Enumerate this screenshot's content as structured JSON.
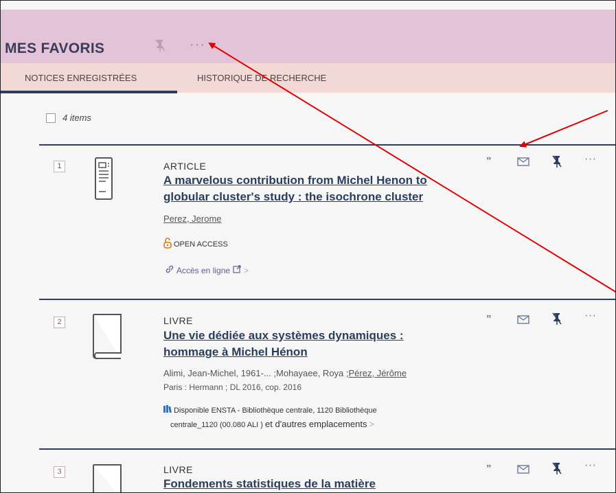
{
  "header": {
    "title": "MES FAVORIS",
    "more": "···"
  },
  "tabs": [
    {
      "label": "NOTICES ENREGISTRÉES"
    },
    {
      "label": "HISTORIQUE DE RECHERCHE"
    }
  ],
  "items_count": "4 items",
  "items": [
    {
      "index": "1",
      "type": "ARTICLE",
      "title_line1": "A marvelous contribution from Michel Henon to",
      "title_line2": "globular cluster's study : the isochrone cluster",
      "author": "Perez, Jerome",
      "open_access": "OPEN ACCESS",
      "online_access": "Accès en ligne"
    },
    {
      "index": "2",
      "type": "LIVRE",
      "title_line1": "Une vie dédiée aux systèmes dynamiques :",
      "title_line2": "hommage à Michel Hénon",
      "authors_plain": "Alimi, Jean-Michel, 1961-... ;Mohayaee, Roya ;",
      "authors_linked": "Pérez, Jérôme",
      "publication": "Paris : Hermann ; DL 2016, cop. 2016",
      "availability_line1": "Disponible ENSTA - Bibliothèque centrale, 1120  Bibliothèque",
      "availability_line2": "centrale_1120 (00.080 ALI )",
      "availability_more": "et d'autres emplacements"
    },
    {
      "index": "3",
      "type": "LIVRE",
      "title_line1": "Fondements statistiques de la matière"
    }
  ],
  "action_labels": {
    "quote": "”",
    "more": "···",
    "chevron": ">"
  },
  "colors": {
    "header_bg": "#e3c3d8",
    "tabs_bg": "#f3d9d6",
    "accent": "#2a3f5f",
    "annotation": "#e00000"
  }
}
